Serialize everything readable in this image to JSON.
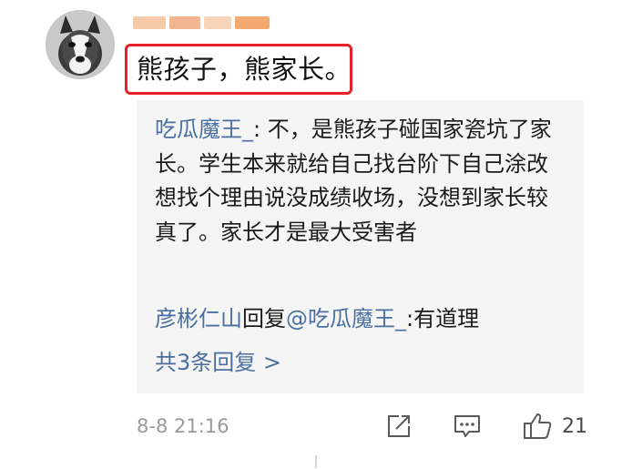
{
  "comment": {
    "text": "熊孩子，熊家长。"
  },
  "reply": {
    "author": "吃瓜魔王_",
    "body": ": 不，是熊孩子碰国家瓷坑了家长。学生本来就给自己找台阶下自己涂改想找个理由说没成绩收场，没想到家长较真了。家长才是最大受害者"
  },
  "subreply": {
    "author": "彦彬仁山",
    "reply_word": "回复",
    "mention": "@吃瓜魔王_",
    "body": ":有道理"
  },
  "more_replies": "共3条回复 >",
  "meta": {
    "timestamp": "8-8 21:16",
    "like_count": "21"
  },
  "colors": {
    "link": "#4a6fa0",
    "highlight_border": "#e8202a",
    "reply_background": "#f5f5f5"
  },
  "icons": {
    "avatar": "husky-avatar",
    "share": "share-icon",
    "comment": "comment-icon",
    "like": "thumbs-up-icon"
  }
}
